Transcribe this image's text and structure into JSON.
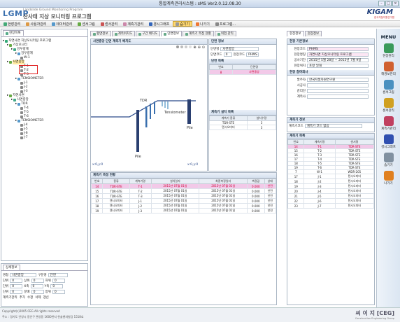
{
  "window": {
    "title": "통합계측관리시스템 : sMS Ver2.0.12.08.30"
  },
  "banner": {
    "logo": "LGMP",
    "logo_sub": "Landslide Ground Monitoring Program",
    "logo_kr": "산사태 지상 모니터링 프로그램",
    "org": "KIGAM",
    "org_sub": "한국지질자원연구원"
  },
  "menubar": {
    "items": [
      {
        "label": "현장관리",
        "color": "#4a7"
      },
      {
        "label": "사용자관리",
        "color": "#d94"
      },
      {
        "label": "데이터관리",
        "color": "#59c"
      },
      {
        "label": "센서그림",
        "color": "#6a4"
      },
      {
        "label": "센서관리",
        "color": "#c55"
      },
      {
        "label": "계측기관리",
        "color": "#c8a"
      },
      {
        "label": "경시그래프",
        "color": "#36b"
      },
      {
        "label": "숨기기",
        "color": "#999"
      },
      {
        "label": "나가기",
        "color": "#e73"
      },
      {
        "label": "프로그램...",
        "color": "#888"
      }
    ],
    "active_index": 7
  },
  "left": {
    "tab": "현장목록",
    "tree": [
      {
        "label": "자연사면 지상모니터링 프로그램",
        "lvl": 0
      },
      {
        "label": "기상모니터",
        "lvl": 1
      },
      {
        "label": "강우량계",
        "lvl": 2
      },
      {
        "label": "강우량계",
        "lvl": 3
      },
      {
        "label": "W-1",
        "lvl": 4
      },
      {
        "label": "사면중앙",
        "lvl": 1,
        "selected": true
      },
      {
        "label": "T-1",
        "lvl": 4
      },
      {
        "label": "T-2",
        "lvl": 4
      },
      {
        "label": "T-3",
        "lvl": 4
      },
      {
        "label": "TENSIOMETER",
        "lvl": 3
      },
      {
        "label": "J-1",
        "lvl": 4
      },
      {
        "label": "J-2",
        "lvl": 4
      },
      {
        "label": "J-3",
        "lvl": 4
      },
      {
        "label": "자연사면",
        "lvl": 1
      },
      {
        "label": "사면중앙",
        "lvl": 2
      },
      {
        "label": "TDR",
        "lvl": 3
      },
      {
        "label": "T-4",
        "lvl": 4
      },
      {
        "label": "T-5",
        "lvl": 4
      },
      {
        "label": "T-6",
        "lvl": 4
      },
      {
        "label": "TENSIOMETER",
        "lvl": 3
      },
      {
        "label": "J-4",
        "lvl": 4
      },
      {
        "label": "J-5",
        "lvl": 4
      },
      {
        "label": "J-6",
        "lvl": 4
      },
      {
        "label": "J-7",
        "lvl": 4
      }
    ],
    "detail_tab": "상세정보",
    "detail": {
      "name_label": "명칭",
      "name_value": "사면중앙",
      "type_label": "구분명",
      "type_value": "단면",
      "rows": [
        [
          "단위",
          "0",
          "상위",
          "0",
          "하위",
          "0"
        ],
        [
          "단위",
          "0",
          "X축",
          "0",
          "Y축",
          "0"
        ],
        [
          "단위",
          "0",
          "분배",
          "0",
          "방위",
          "0"
        ]
      ]
    },
    "buttons": {
      "save": "계측기관리",
      "add": "추가",
      "edit": "수정",
      "delete": "삭제",
      "refresh": "갱신"
    }
  },
  "center": {
    "tabs": [
      "평면정보",
      "계측위치도",
      "구간 배치도",
      "단면정보",
      "계측기 측정 현황",
      "위험 관리"
    ],
    "active_tab": 3,
    "diagram_title": "사면중앙 단면 계측기 배치도",
    "diagram_labels": {
      "tdr": "TDR",
      "tensiometer": "Tensiometer",
      "pile_a": "Pile",
      "pile_b": "Pile"
    },
    "coords": {
      "left": "x:0,y:0",
      "right": "x:0,y:0"
    },
    "section_info": {
      "title": "단면 정보",
      "name_label": "단면명",
      "name_value": "사면중앙",
      "code_label": "단면코드",
      "code_value": "0",
      "site_label": "현장코드",
      "site_value": "PHMS"
    },
    "section_list": {
      "title": "단면 목록",
      "cols": [
        "번호",
        "단면명"
      ],
      "rows": [
        [
          "8",
          "사면중앙"
        ]
      ]
    },
    "sensor_list": {
      "title": "계측기 설치 목록",
      "cols": [
        "계측기 종류",
        "설치수량"
      ],
      "rows": [
        [
          "TDR-STE",
          "3"
        ],
        [
          "텐시오미터",
          "3"
        ]
      ]
    },
    "status": {
      "title": "계측기 측정 현황",
      "cols": [
        "번호",
        "종류",
        "계측기명",
        "설치일자",
        "최종측정일자",
        "측정값",
        "상태"
      ],
      "rows": [
        [
          "14",
          "TDR-STE",
          "T-1",
          "2015년 07월 01일",
          "2015년 07월 01일",
          "0.000",
          "안전"
        ],
        [
          "15",
          "TDR-STE",
          "T-2",
          "2015년 07월 01일",
          "2015년 07월 01일",
          "0.000",
          "안전"
        ],
        [
          "16",
          "TDR-STE",
          "T-3",
          "2015년 07월 01일",
          "2015년 07월 01일",
          "0.000",
          "안전"
        ],
        [
          "17",
          "텐시오미터",
          "J-1",
          "2015년 07월 01일",
          "2015년 07월 01일",
          "0.000",
          "안전"
        ],
        [
          "18",
          "텐시오미터",
          "J-2",
          "2015년 07월 01일",
          "2015년 07월 01일",
          "0.000",
          "안전"
        ],
        [
          "19",
          "텐시오미터",
          "J-3",
          "2015년 07월 01일",
          "2015년 07월 01일",
          "0.000",
          "안전"
        ]
      ],
      "selected": 0
    }
  },
  "right": {
    "tabs": [
      "현장정보",
      "현장정보"
    ],
    "site": {
      "title": "현장 기본정보",
      "fields": [
        [
          "현장코드",
          "PHMS"
        ],
        [
          "현장명칭",
          "자연사면 지상모니터링 프로그램"
        ],
        [
          "공사기간",
          "2015년 5월 28일 ~ 2015년 7월 9일"
        ],
        [
          "현장위치",
          "포항 일대"
        ]
      ]
    },
    "manager": {
      "title": "현장 참여회사",
      "fields": [
        [
          "발주자",
          "한국지질자원연구원"
        ],
        [
          "시공사",
          ""
        ],
        [
          "감리단",
          ""
        ],
        [
          "계측사",
          ""
        ]
      ]
    },
    "sensor_info": {
      "title": "계측기 정보",
      "code_label": "계측기코드",
      "code_value": "계측기 코드 없음"
    },
    "sensor_list": {
      "title": "계측기 목록",
      "cols": [
        "번호",
        "계측기명",
        "센서명"
      ],
      "rows": [
        [
          "14",
          "T-1",
          "TDR-STE"
        ],
        [
          "15",
          "T-2",
          "TDR-STE"
        ],
        [
          "16",
          "T-3",
          "TDR-STE"
        ],
        [
          "17",
          "T-4",
          "TDR-STE"
        ],
        [
          "18",
          "T-5",
          "TDR-STE"
        ],
        [
          "19",
          "T-6",
          "TDR-STE"
        ],
        [
          "7",
          "W-1",
          "WDR-205"
        ],
        [
          "17",
          "J-1",
          "텐시오미터"
        ],
        [
          "18",
          "J-2",
          "텐시오미터"
        ],
        [
          "19",
          "J-3",
          "텐시오미터"
        ],
        [
          "20",
          "J-4",
          "텐시오미터"
        ],
        [
          "21",
          "J-5",
          "텐시오미터"
        ],
        [
          "22",
          "J-6",
          "텐시오미터"
        ],
        [
          "23",
          "J-7",
          "텐시오미터"
        ]
      ],
      "selected": 0
    }
  },
  "side_menu": {
    "title": "MENU",
    "items": [
      {
        "label": "현장관리",
        "color": "#3a9a5a"
      },
      {
        "label": "해경보관리",
        "color": "#d06030"
      },
      {
        "label": "센서그림",
        "color": "#4a90c0"
      },
      {
        "label": "센서관리",
        "color": "#d0a020"
      },
      {
        "label": "계측기관리",
        "color": "#c04060"
      },
      {
        "label": "경시그래프",
        "color": "#3050b0"
      },
      {
        "label": "숨기기",
        "color": "#8090a0"
      },
      {
        "label": "나가기",
        "color": "#e08020"
      }
    ]
  },
  "status_bar": {
    "copyright": "Copyright(c)2005 CEG All rights reserved",
    "address": "주소 : 경기도 안양시 동안구 관양동 1600번지 한솔벤처빌딩 1518호",
    "company": "씨 이 지 [CEG]",
    "company_sub": "Construction Engineering Group"
  }
}
